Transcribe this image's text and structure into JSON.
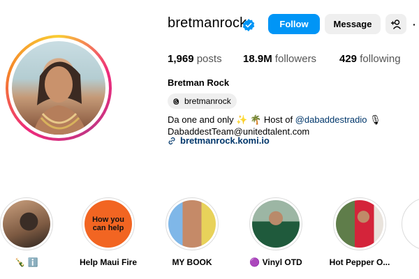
{
  "profile": {
    "username": "bretmanrock",
    "follow_label": "Follow",
    "message_label": "Message",
    "more_label": "·",
    "stats": {
      "posts_count": "1,969",
      "posts_label": "posts",
      "followers_count": "18.9M",
      "followers_label": "followers",
      "following_count": "429",
      "following_label": "following"
    },
    "full_name": "Bretman Rock",
    "threads_handle": "bretmanrock",
    "bio_line1_a": "Da one and only ✨ 🌴 Host of ",
    "bio_mention": "@dabaddestradio",
    "bio_line1_b": " 🎙",
    "bio_line2": "DabaddestTeam@unitedtalent.com",
    "link": "bretmanrock.komi.io"
  },
  "highlights": [
    {
      "label": "🍾 ℹ️"
    },
    {
      "label": "Help Maui Fire",
      "image_text": "How you can help"
    },
    {
      "label": "MY BOOK"
    },
    {
      "label": "🟣 Vinyl OTD"
    },
    {
      "label": "Hot Pepper O..."
    }
  ],
  "colors": {
    "follow_blue": "#0095f6",
    "link_blue": "#00376b",
    "verified_blue": "#0095f6"
  }
}
